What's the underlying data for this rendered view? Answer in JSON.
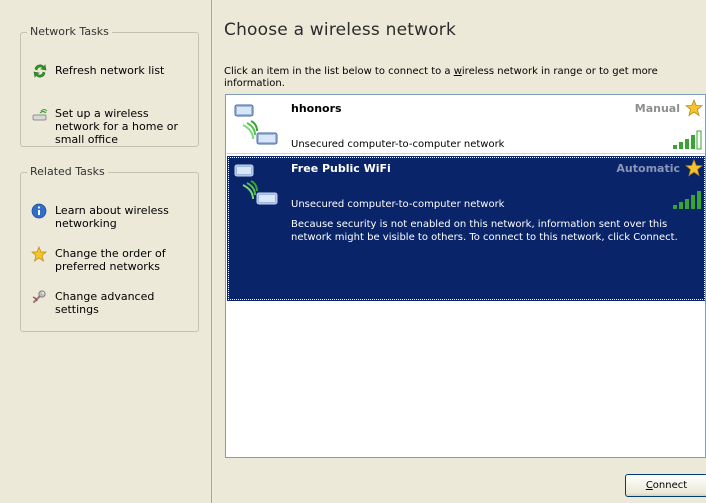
{
  "left_pane": {
    "network_tasks": {
      "title": "Network Tasks",
      "items": [
        {
          "label": "Refresh network list",
          "icon": "refresh-icon"
        },
        {
          "label": "Set up a wireless network for a home or small office",
          "icon": "wireless-setup-icon"
        }
      ]
    },
    "related_tasks": {
      "title": "Related Tasks",
      "items": [
        {
          "label": "Learn about wireless networking",
          "icon": "info-icon"
        },
        {
          "label": "Change the order of preferred networks",
          "icon": "star-icon"
        },
        {
          "label": "Change advanced settings",
          "icon": "settings-icon"
        }
      ]
    }
  },
  "main": {
    "title": "Choose a wireless network",
    "description_part1": "Click an item in the list below to connect to a ",
    "description_underlined": "w",
    "description_part2": "ireless network in range or to get more information.",
    "networks": [
      {
        "name": "hhonors",
        "mode": "Manual",
        "security": "Unsecured computer-to-computer network",
        "selected": false,
        "signal_bars": 5,
        "signal_color": "#3aa335"
      },
      {
        "name": "Free Public WiFi",
        "mode": "Automatic",
        "security": "Unsecured computer-to-computer network",
        "warning": "Because security is not enabled on this network, information sent over this network might be visible to others. To connect to this network, click Connect.",
        "selected": true,
        "signal_bars": 5,
        "signal_color": "#3aa335"
      }
    ],
    "connect_button": {
      "accel": "C",
      "rest": "onnect"
    }
  },
  "colors": {
    "selection": "#0a246a",
    "panel": "#ece9d8",
    "list_border": "#7f9db9"
  }
}
